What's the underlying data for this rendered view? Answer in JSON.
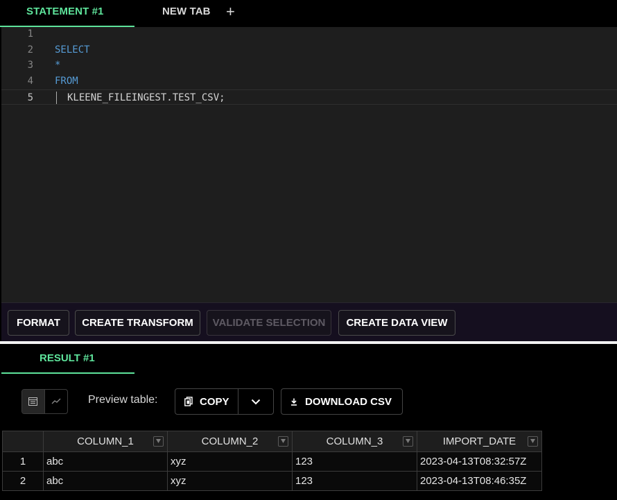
{
  "tabs": {
    "active_label": "STATEMENT #1",
    "new_tab_label": "NEW TAB",
    "add_symbol": "+"
  },
  "editor": {
    "lines": [
      {
        "num": "1",
        "text": ""
      },
      {
        "num": "2",
        "text": "SELECT"
      },
      {
        "num": "3",
        "text": "*"
      },
      {
        "num": "4",
        "text": "FROM"
      },
      {
        "num": "5",
        "text": "KLEENE_FILEINGEST.TEST_CSV;"
      }
    ]
  },
  "toolbar": {
    "format": "FORMAT",
    "create_transform": "CREATE TRANSFORM",
    "validate_selection": "VALIDATE SELECTION",
    "create_data_view": "CREATE DATA VIEW"
  },
  "results": {
    "tab_label": "RESULT #1",
    "preview_label": "Preview table:",
    "copy_label": "COPY",
    "download_label": "DOWNLOAD CSV",
    "icons": [
      "table-icon",
      "chart-line-icon",
      "copy-icon",
      "chevron-down-icon",
      "download-icon",
      "filter-icon"
    ],
    "columns": [
      "COLUMN_1",
      "COLUMN_2",
      "COLUMN_3",
      "IMPORT_DATE"
    ],
    "rows": [
      {
        "num": "1",
        "cells": [
          "abc",
          "xyz",
          "123",
          "2023-04-13T08:32:57Z"
        ]
      },
      {
        "num": "2",
        "cells": [
          "abc",
          "xyz",
          "123",
          "2023-04-13T08:46:35Z"
        ]
      }
    ]
  },
  "colors": {
    "accent": "#5ee49b",
    "keyword": "#569cd6",
    "toolbar_bg": "#150f1f"
  }
}
